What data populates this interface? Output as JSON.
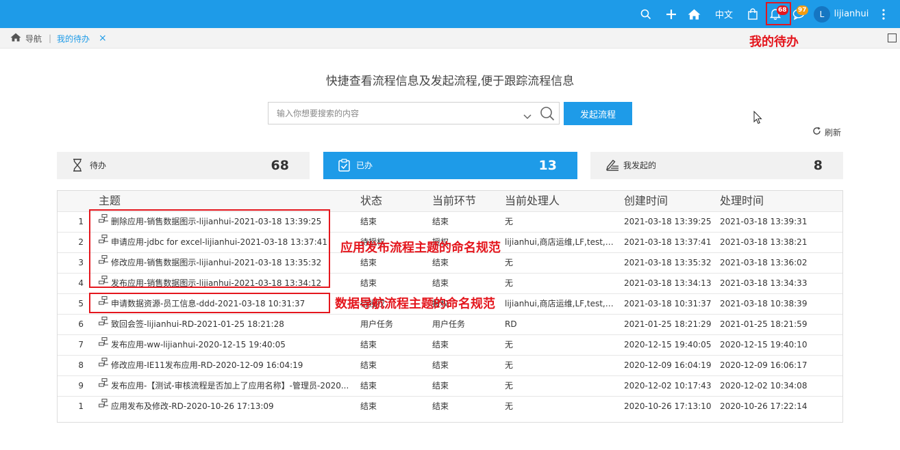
{
  "topbar": {
    "lang": "中文",
    "notify_badge": "68",
    "msg_badge": "97",
    "avatar_letter": "L",
    "username": "lijianhui",
    "colors": {
      "bar": "#1e9be8",
      "notify_badge": "#e4161d",
      "msg_badge": "#f39c12"
    },
    "icons": [
      "search-icon",
      "plus-icon",
      "home-icon",
      "bag-icon",
      "bell-icon",
      "message-icon",
      "more-icon"
    ]
  },
  "breadcrumb": {
    "home": "导航",
    "current": "我的待办",
    "close": "×"
  },
  "annotations": {
    "bell": "我的待办",
    "app_naming": "应用发布流程主题的命名规范",
    "data_naming": "数据导航流程主题的命名规范"
  },
  "heading": "快捷查看流程信息及发起流程,便于跟踪流程信息",
  "search": {
    "placeholder": "输入你想要搜索的内容",
    "button": "发起流程"
  },
  "refresh": "刷新",
  "cards": [
    {
      "label": "待办",
      "count": "68",
      "icon": "hourglass-icon"
    },
    {
      "label": "已办",
      "count": "13",
      "icon": "clipboard-check-icon"
    },
    {
      "label": "我发起的",
      "count": "8",
      "icon": "pen-list-icon"
    }
  ],
  "table": {
    "headers": [
      "主题",
      "状态",
      "当前环节",
      "当前处理人",
      "创建时间",
      "处理时间"
    ],
    "rows": [
      {
        "no": "1",
        "subject": "删除应用-销售数据图示-lijianhui-2021-03-18 13:39:25",
        "status": "结束",
        "stage": "结束",
        "handler": "无",
        "created": "2021-03-18 13:39:25",
        "handled": "2021-03-18 13:39:31"
      },
      {
        "no": "2",
        "subject": "申请应用-jdbc for excel-lijianhui-2021-03-18 13:37:41",
        "status": "待授权",
        "stage": "授权",
        "handler": "lijianhui,商店运维,LF,test,审...",
        "created": "2021-03-18 13:37:41",
        "handled": "2021-03-18 13:38:21"
      },
      {
        "no": "3",
        "subject": "修改应用-销售数据图示-lijianhui-2021-03-18 13:35:32",
        "status": "结束",
        "stage": "结束",
        "handler": "无",
        "created": "2021-03-18 13:35:32",
        "handled": "2021-03-18 13:36:02"
      },
      {
        "no": "4",
        "subject": "发布应用-销售数据图示-lijianhui-2021-03-18 13:34:12",
        "status": "结束",
        "stage": "结束",
        "handler": "无",
        "created": "2021-03-18 13:34:13",
        "handled": "2021-03-18 13:34:33"
      },
      {
        "no": "5",
        "subject": "申请数据资源-员工信息-ddd-2021-03-18 10:31:37",
        "status": "待授权",
        "stage": "授权",
        "handler": "lijianhui,商店运维,LF,test,审...",
        "created": "2021-03-18 10:31:37",
        "handled": "2021-03-18 10:38:39"
      },
      {
        "no": "6",
        "subject": "致回会签-lijianhui-RD-2021-01-25 18:21:28",
        "status": "用户任务",
        "stage": "用户任务",
        "handler": "RD",
        "created": "2021-01-25 18:21:29",
        "handled": "2021-01-25 18:21:59"
      },
      {
        "no": "7",
        "subject": "发布应用-ww-lijianhui-2020-12-15 19:40:05",
        "status": "结束",
        "stage": "结束",
        "handler": "无",
        "created": "2020-12-15 19:40:05",
        "handled": "2020-12-15 19:40:10"
      },
      {
        "no": "8",
        "subject": "修改应用-IE11发布应用-RD-2020-12-09 16:04:19",
        "status": "结束",
        "stage": "结束",
        "handler": "无",
        "created": "2020-12-09 16:04:19",
        "handled": "2020-12-09 16:06:17"
      },
      {
        "no": "9",
        "subject": "发布应用-【测试-审核流程是否加上了应用名称】-管理员-2020...",
        "status": "结束",
        "stage": "结束",
        "handler": "无",
        "created": "2020-12-02 10:17:43",
        "handled": "2020-12-02 10:34:08"
      },
      {
        "no": "1",
        "subject": "应用发布及修改-RD-2020-10-26 17:13:09",
        "status": "结束",
        "stage": "结束",
        "handler": "无",
        "created": "2020-10-26 17:13:10",
        "handled": "2020-10-26 17:22:14"
      }
    ]
  }
}
